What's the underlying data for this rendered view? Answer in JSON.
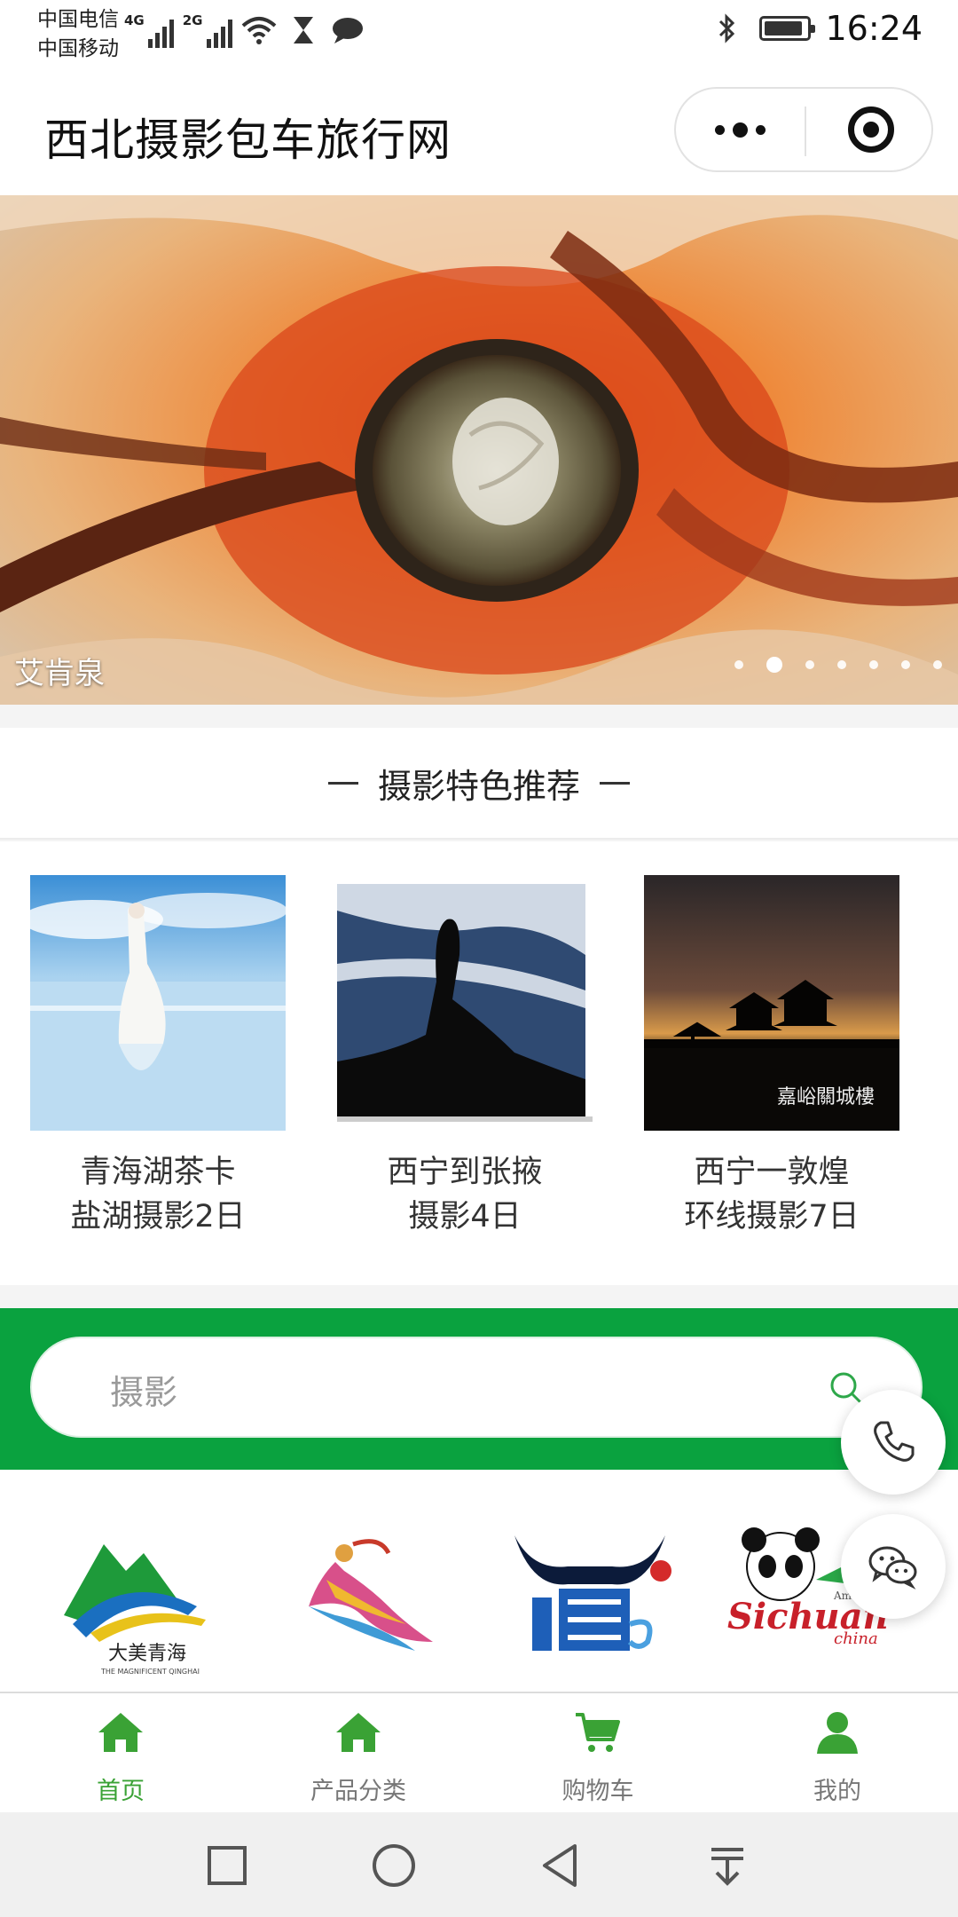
{
  "status_bar": {
    "carrier1": "中国电信",
    "carrier2": "中国移动",
    "net1": "4G",
    "net2": "2G",
    "time": "16:24",
    "battery_level": 0.85
  },
  "header": {
    "title": "西北摄影包车旅行网",
    "more_icon": "more-dots-icon",
    "close_icon": "target-close-icon"
  },
  "banner": {
    "caption": "艾肯泉",
    "slide_count": 7,
    "active_slide": 1
  },
  "section": {
    "title": "摄影特色推荐"
  },
  "products": [
    {
      "line1": "青海湖茶卡",
      "line2": "盐湖摄影2日"
    },
    {
      "line1": "西宁到张掖",
      "line2": "摄影4日"
    },
    {
      "line1": "西宁一敦煌",
      "line2": "环线摄影7日"
    }
  ],
  "product_image_text": "嘉峪關城樓",
  "search": {
    "placeholder": "摄影"
  },
  "logo_texts": {
    "qinghai": "大美青海",
    "qinghai_en": "THE MAGNIFICENT QINGHAI",
    "sichuan": "Sichuan",
    "sichuan_small": "Amazing",
    "china": "china"
  },
  "tabs": [
    {
      "label": "首页",
      "icon": "home-icon"
    },
    {
      "label": "产品分类",
      "icon": "home-icon"
    },
    {
      "label": "购物车",
      "icon": "cart-icon"
    },
    {
      "label": "我的",
      "icon": "user-icon"
    }
  ],
  "colors": {
    "brand_green": "#0aa23f",
    "tab_green": "#3aa235",
    "tab_inactive": "#777777"
  }
}
